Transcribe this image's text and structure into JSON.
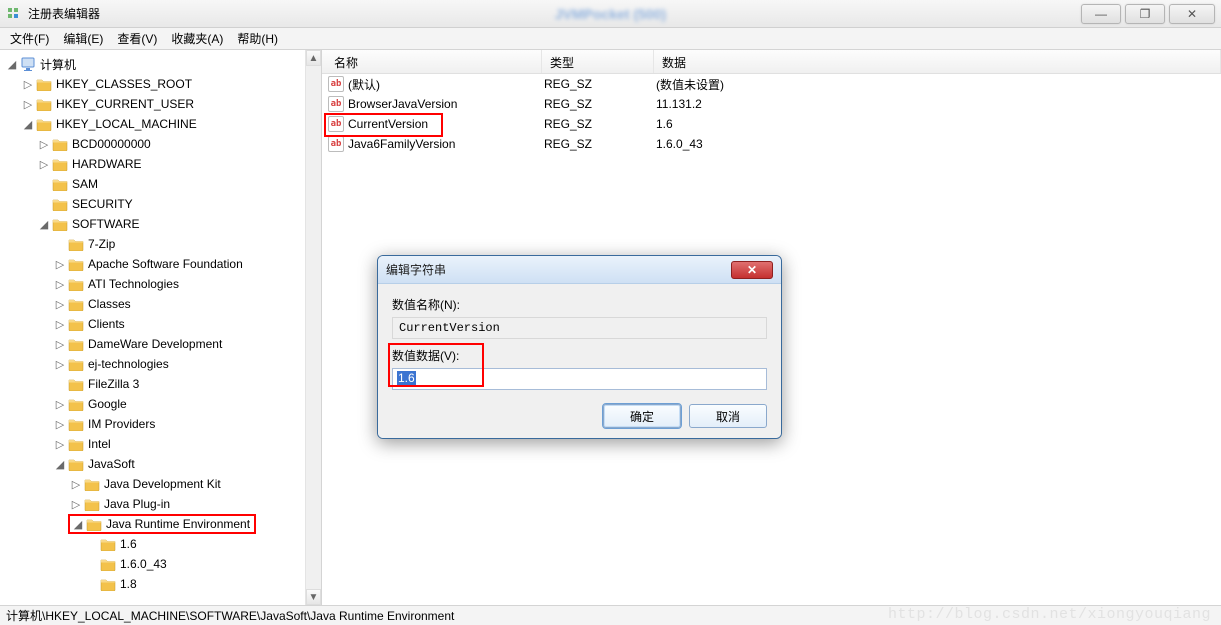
{
  "window": {
    "title": "注册表编辑器",
    "blur_hint": "JVMPocket (500)",
    "buttons": {
      "min": "—",
      "max": "❐",
      "close": "✕"
    }
  },
  "menu": [
    "文件(F)",
    "编辑(E)",
    "查看(V)",
    "收藏夹(A)",
    "帮助(H)"
  ],
  "tree": {
    "root": "计算机",
    "hives": [
      {
        "label": "HKEY_CLASSES_ROOT",
        "expandable": true
      },
      {
        "label": "HKEY_CURRENT_USER",
        "expandable": true
      },
      {
        "label": "HKEY_LOCAL_MACHINE",
        "expandable": true,
        "expanded": true,
        "children": [
          {
            "label": "BCD00000000",
            "expandable": true
          },
          {
            "label": "HARDWARE",
            "expandable": true
          },
          {
            "label": "SAM",
            "expandable": false
          },
          {
            "label": "SECURITY",
            "expandable": false
          },
          {
            "label": "SOFTWARE",
            "expandable": true,
            "expanded": true,
            "children": [
              {
                "label": "7-Zip",
                "expandable": false
              },
              {
                "label": "Apache Software Foundation",
                "expandable": true
              },
              {
                "label": "ATI Technologies",
                "expandable": true
              },
              {
                "label": "Classes",
                "expandable": true
              },
              {
                "label": "Clients",
                "expandable": true
              },
              {
                "label": "DameWare Development",
                "expandable": true
              },
              {
                "label": "ej-technologies",
                "expandable": true
              },
              {
                "label": "FileZilla 3",
                "expandable": false
              },
              {
                "label": "Google",
                "expandable": true
              },
              {
                "label": "IM Providers",
                "expandable": true
              },
              {
                "label": "Intel",
                "expandable": true
              },
              {
                "label": "JavaSoft",
                "expandable": true,
                "expanded": true,
                "children": [
                  {
                    "label": "Java Development Kit",
                    "expandable": true
                  },
                  {
                    "label": "Java Plug-in",
                    "expandable": true
                  },
                  {
                    "label": "Java Runtime Environment",
                    "expandable": true,
                    "expanded": true,
                    "highlight": true,
                    "children": [
                      {
                        "label": "1.6",
                        "expandable": false
                      },
                      {
                        "label": "1.6.0_43",
                        "expandable": false
                      },
                      {
                        "label": "1.8",
                        "expandable": false
                      }
                    ]
                  }
                ]
              }
            ]
          }
        ]
      }
    ]
  },
  "list": {
    "headers": {
      "name": "名称",
      "type": "类型",
      "data": "数据"
    },
    "rows": [
      {
        "name": "(默认)",
        "type": "REG_SZ",
        "data": "(数值未设置)"
      },
      {
        "name": "BrowserJavaVersion",
        "type": "REG_SZ",
        "data": "11.131.2"
      },
      {
        "name": "CurrentVersion",
        "type": "REG_SZ",
        "data": "1.6",
        "highlight": true
      },
      {
        "name": "Java6FamilyVersion",
        "type": "REG_SZ",
        "data": "1.6.0_43"
      }
    ]
  },
  "dialog": {
    "title": "编辑字符串",
    "name_label": "数值名称(N):",
    "name_value": "CurrentVersion",
    "data_label": "数值数据(V):",
    "data_value": "1.6",
    "ok": "确定",
    "cancel": "取消",
    "close_glyph": "✕"
  },
  "status": "计算机\\HKEY_LOCAL_MACHINE\\SOFTWARE\\JavaSoft\\Java Runtime Environment",
  "watermark": "http://blog.csdn.net/xiongyouqiang"
}
